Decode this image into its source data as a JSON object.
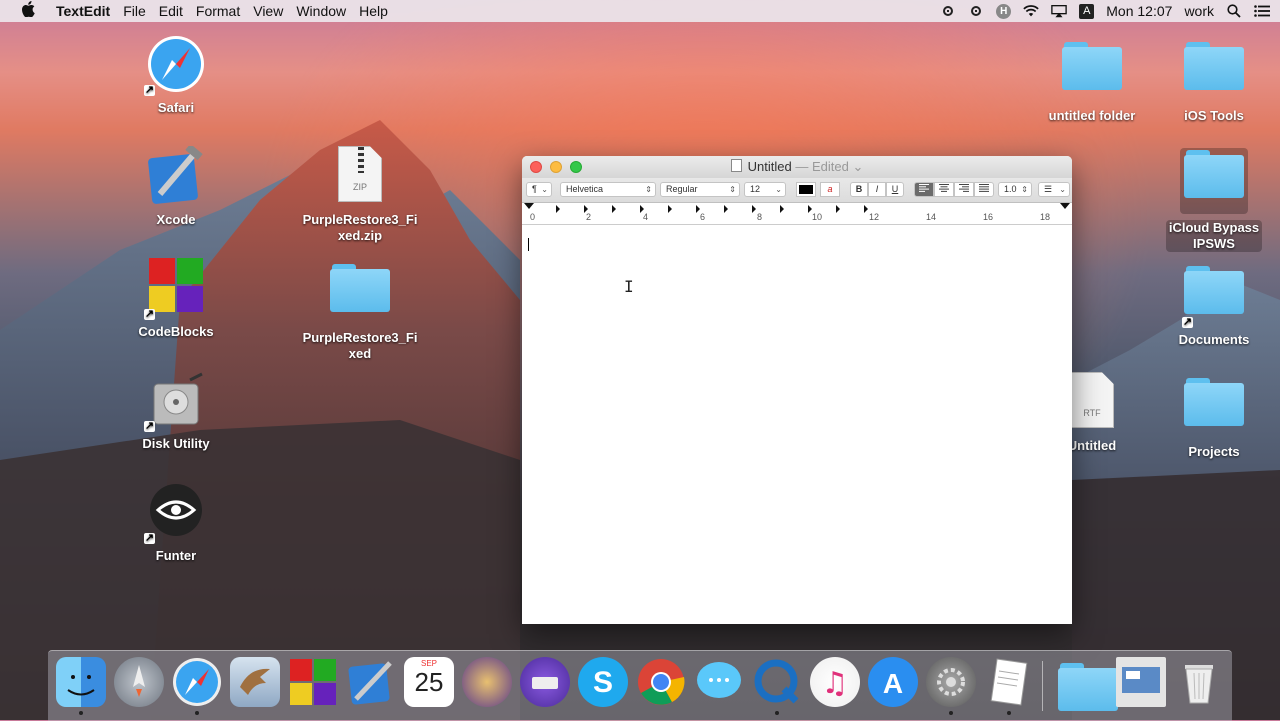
{
  "menubar": {
    "apple": "",
    "app_name": "TextEdit",
    "items": [
      "File",
      "Edit",
      "Format",
      "View",
      "Window",
      "Help"
    ],
    "clock": "Mon 12:07",
    "user": "work",
    "status_icons": [
      "record-icon",
      "record-icon",
      "h-icon",
      "wifi-icon",
      "airplay-icon",
      "input-source-icon",
      "spotlight-icon",
      "notification-center-icon"
    ],
    "input_source_letter": "A",
    "h_letter": "H"
  },
  "desktop": {
    "left": [
      {
        "label": "Safari",
        "icon": "safari-icon"
      },
      {
        "label": "Xcode",
        "icon": "xcode-icon"
      },
      {
        "label": "CodeBlocks",
        "icon": "codeblocks-icon"
      },
      {
        "label": "Disk Utility",
        "icon": "disk-utility-icon"
      },
      {
        "label": "Funter",
        "icon": "funter-icon"
      }
    ],
    "middle": [
      {
        "label": "PurpleRestore3_Fixed.zip",
        "icon": "zip-file-icon",
        "badge": "ZIP"
      },
      {
        "label": "PurpleRestore3_Fixed",
        "icon": "folder-icon"
      }
    ],
    "right": [
      {
        "label": "untitled folder",
        "icon": "folder-icon"
      },
      {
        "label": "iOS Tools",
        "icon": "folder-icon"
      },
      {
        "label": "iCloud Bypass IPSWS",
        "icon": "folder-icon"
      },
      {
        "label": "Documents",
        "icon": "folder-icon"
      },
      {
        "label": "Untitled",
        "icon": "rtf-file-icon",
        "badge": "RTF"
      },
      {
        "label": "Projects",
        "icon": "folder-icon"
      }
    ]
  },
  "window": {
    "title": "Untitled",
    "edited": "— Edited",
    "toolbar": {
      "paragraph": "¶",
      "font": "Helvetica",
      "style": "Regular",
      "size": "12",
      "bold": "B",
      "italic": "I",
      "underline": "U",
      "line_spacing": "1.0",
      "text_color": "#000000"
    },
    "ruler_numbers": [
      "0",
      "2",
      "4",
      "6",
      "8",
      "10",
      "12",
      "14",
      "16",
      "18"
    ],
    "body_text": ""
  },
  "dock": {
    "apps": [
      "finder-icon",
      "launchpad-icon",
      "safari-icon",
      "mail-icon",
      "codeblocks-icon",
      "xcode-icon",
      "calendar-icon",
      "blender-icon",
      "disk-icon",
      "skype-icon",
      "chrome-icon",
      "messages-icon",
      "quicktime-icon",
      "itunes-icon",
      "app-store-icon",
      "system-preferences-icon",
      "textedit-icon",
      "downloads-icon",
      "preview-icon",
      "trash-icon"
    ],
    "calendar_month": "SEP",
    "calendar_day": "25"
  }
}
